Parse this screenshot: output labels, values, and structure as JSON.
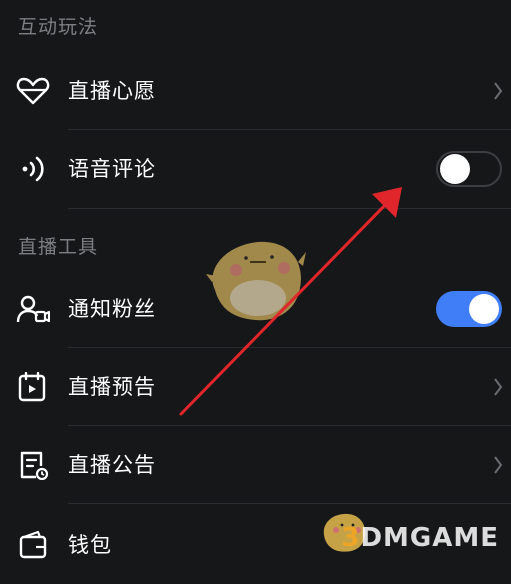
{
  "sections": {
    "interactive_title": "互动玩法",
    "tools_title": "直播工具"
  },
  "rows": [
    {
      "label": "直播心愿",
      "icon": "heart-gift-icon",
      "control": "chevron"
    },
    {
      "label": "语音评论",
      "icon": "voice-wave-icon",
      "control": "toggle",
      "on": false
    },
    {
      "label": "通知粉丝",
      "icon": "notify-fans-icon",
      "control": "toggle",
      "on": true
    },
    {
      "label": "直播预告",
      "icon": "calendar-play-icon",
      "control": "chevron"
    },
    {
      "label": "直播公告",
      "icon": "announcement-doc-icon",
      "control": "chevron"
    },
    {
      "label": "钱包",
      "icon": "wallet-icon",
      "control": "chevron"
    }
  ],
  "colors": {
    "background": "#161719",
    "toggle_on": "#3f7ef7",
    "annotation_arrow": "#e0262b",
    "watermark_accent": "#f5a623"
  },
  "watermark": {
    "prefix": "3",
    "brand": "DMGAME"
  }
}
